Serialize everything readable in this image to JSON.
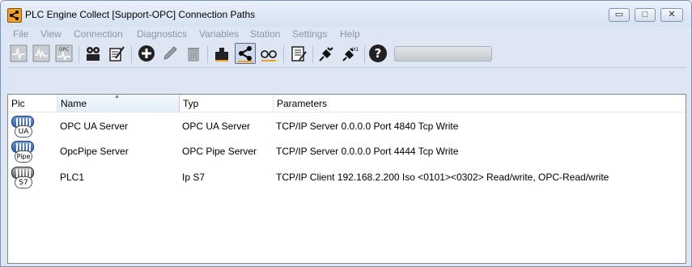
{
  "window": {
    "title": "PLC Engine Collect [Support-OPC] Connection Paths",
    "controls": {
      "minimize": "▭",
      "maximize": "□",
      "close": "✕"
    }
  },
  "menu": [
    "File",
    "View",
    "Connection",
    "Diagnostics",
    "Variables",
    "Station",
    "Settings",
    "Help"
  ],
  "toolbar": {
    "icons": [
      "signal-icon",
      "signal-zigzag-icon",
      "opc-signal-icon",
      "film-icon",
      "edit-list-icon",
      "add-icon",
      "pencil-icon",
      "trash-icon",
      "puzzle-icon",
      "share-icon",
      "glasses-icon",
      "list-edit-icon",
      "plug-icon",
      "plug-h1-icon",
      "help-icon"
    ],
    "opc_label": "OPC",
    "h1_label": "H1",
    "help_label": "?",
    "active": "share-icon"
  },
  "table": {
    "columns": [
      "Pic",
      "Name",
      "Typ",
      "Parameters"
    ],
    "sorted_column": "Name",
    "rows": [
      {
        "pic": "UA",
        "name": "OPC UA Server",
        "typ": "OPC UA Server",
        "params": "TCP/IP Server 0.0.0.0 Port 4840 Tcp  Write"
      },
      {
        "pic": "Pipe",
        "name": "OpcPipe Server",
        "typ": "OPC Pipe Server",
        "params": "TCP/IP Server 0.0.0.0 Port 4444 Tcp  Write"
      },
      {
        "pic": "S7",
        "name": "PLC1",
        "typ": "Ip S7",
        "params": "TCP/IP Client 192.168.2.200 Iso <0101><0302> Read/write, OPC-Read/write"
      }
    ]
  },
  "colors": {
    "frame": "#dde6f2",
    "accent": "#f0a020",
    "pic_blue": "#2d5ea8",
    "pic_gray": "#5c5c5c",
    "menu_disabled": "#8d96a3"
  }
}
